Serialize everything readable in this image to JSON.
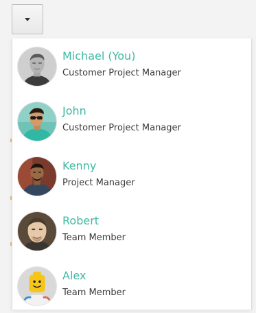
{
  "toggle": {
    "icon": "caret-down-icon"
  },
  "users": [
    {
      "name": "Michael (You)",
      "role": "Customer Project Manager",
      "avatar": "avatar-michael"
    },
    {
      "name": "John",
      "role": "Customer Project Manager",
      "avatar": "avatar-john"
    },
    {
      "name": "Kenny",
      "role": "Project Manager",
      "avatar": "avatar-kenny"
    },
    {
      "name": "Robert",
      "role": "Team Member",
      "avatar": "avatar-robert"
    },
    {
      "name": "Alex",
      "role": "Team Member",
      "avatar": "avatar-alex"
    }
  ],
  "colors": {
    "name": "#3fb9a3",
    "role": "#3a3a3a",
    "background": "#f3f3f3",
    "menu": "#ffffff"
  }
}
